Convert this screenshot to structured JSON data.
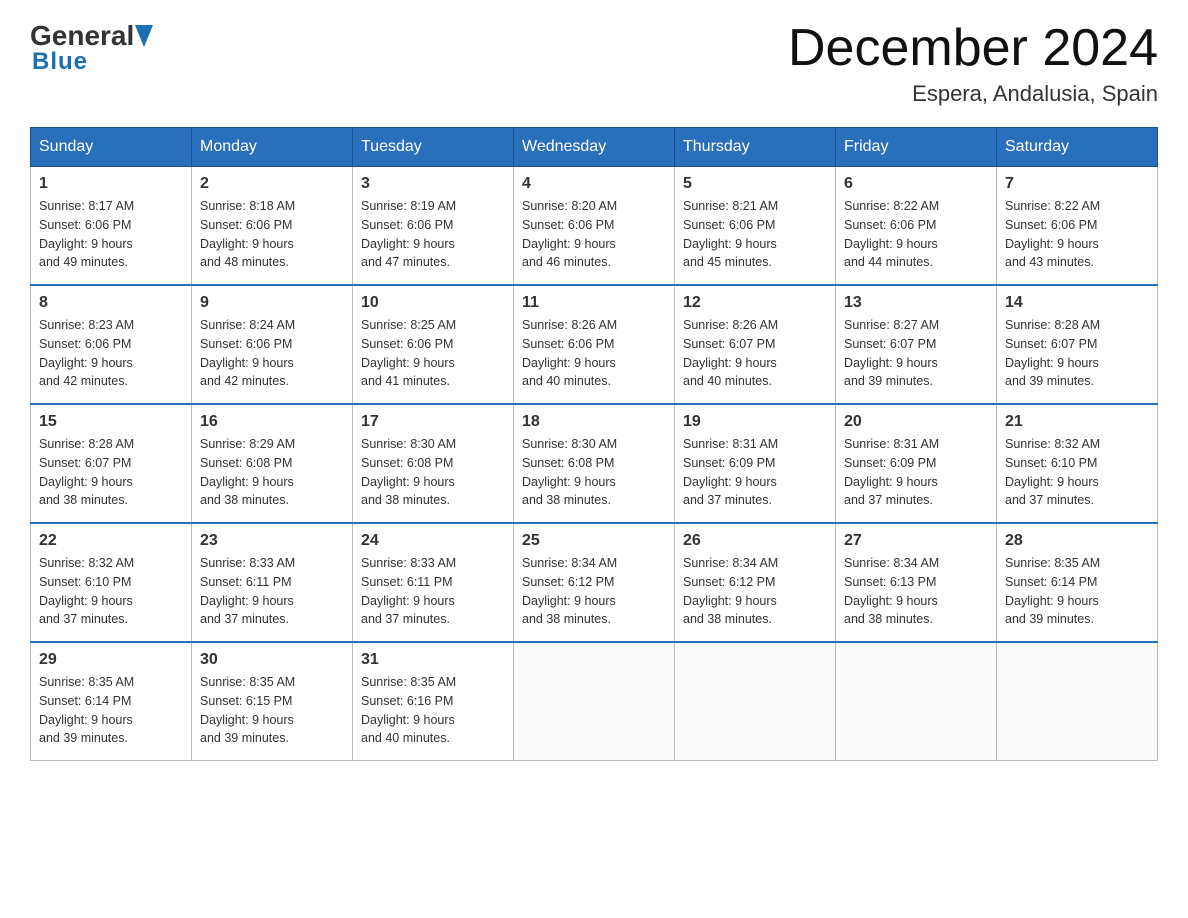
{
  "header": {
    "logo_general": "General",
    "logo_blue": "Blue",
    "month_title": "December 2024",
    "location": "Espera, Andalusia, Spain"
  },
  "calendar": {
    "days_of_week": [
      "Sunday",
      "Monday",
      "Tuesday",
      "Wednesday",
      "Thursday",
      "Friday",
      "Saturday"
    ],
    "weeks": [
      [
        {
          "day": "1",
          "sunrise": "8:17 AM",
          "sunset": "6:06 PM",
          "daylight": "9 hours and 49 minutes."
        },
        {
          "day": "2",
          "sunrise": "8:18 AM",
          "sunset": "6:06 PM",
          "daylight": "9 hours and 48 minutes."
        },
        {
          "day": "3",
          "sunrise": "8:19 AM",
          "sunset": "6:06 PM",
          "daylight": "9 hours and 47 minutes."
        },
        {
          "day": "4",
          "sunrise": "8:20 AM",
          "sunset": "6:06 PM",
          "daylight": "9 hours and 46 minutes."
        },
        {
          "day": "5",
          "sunrise": "8:21 AM",
          "sunset": "6:06 PM",
          "daylight": "9 hours and 45 minutes."
        },
        {
          "day": "6",
          "sunrise": "8:22 AM",
          "sunset": "6:06 PM",
          "daylight": "9 hours and 44 minutes."
        },
        {
          "day": "7",
          "sunrise": "8:22 AM",
          "sunset": "6:06 PM",
          "daylight": "9 hours and 43 minutes."
        }
      ],
      [
        {
          "day": "8",
          "sunrise": "8:23 AM",
          "sunset": "6:06 PM",
          "daylight": "9 hours and 42 minutes."
        },
        {
          "day": "9",
          "sunrise": "8:24 AM",
          "sunset": "6:06 PM",
          "daylight": "9 hours and 42 minutes."
        },
        {
          "day": "10",
          "sunrise": "8:25 AM",
          "sunset": "6:06 PM",
          "daylight": "9 hours and 41 minutes."
        },
        {
          "day": "11",
          "sunrise": "8:26 AM",
          "sunset": "6:06 PM",
          "daylight": "9 hours and 40 minutes."
        },
        {
          "day": "12",
          "sunrise": "8:26 AM",
          "sunset": "6:07 PM",
          "daylight": "9 hours and 40 minutes."
        },
        {
          "day": "13",
          "sunrise": "8:27 AM",
          "sunset": "6:07 PM",
          "daylight": "9 hours and 39 minutes."
        },
        {
          "day": "14",
          "sunrise": "8:28 AM",
          "sunset": "6:07 PM",
          "daylight": "9 hours and 39 minutes."
        }
      ],
      [
        {
          "day": "15",
          "sunrise": "8:28 AM",
          "sunset": "6:07 PM",
          "daylight": "9 hours and 38 minutes."
        },
        {
          "day": "16",
          "sunrise": "8:29 AM",
          "sunset": "6:08 PM",
          "daylight": "9 hours and 38 minutes."
        },
        {
          "day": "17",
          "sunrise": "8:30 AM",
          "sunset": "6:08 PM",
          "daylight": "9 hours and 38 minutes."
        },
        {
          "day": "18",
          "sunrise": "8:30 AM",
          "sunset": "6:08 PM",
          "daylight": "9 hours and 38 minutes."
        },
        {
          "day": "19",
          "sunrise": "8:31 AM",
          "sunset": "6:09 PM",
          "daylight": "9 hours and 37 minutes."
        },
        {
          "day": "20",
          "sunrise": "8:31 AM",
          "sunset": "6:09 PM",
          "daylight": "9 hours and 37 minutes."
        },
        {
          "day": "21",
          "sunrise": "8:32 AM",
          "sunset": "6:10 PM",
          "daylight": "9 hours and 37 minutes."
        }
      ],
      [
        {
          "day": "22",
          "sunrise": "8:32 AM",
          "sunset": "6:10 PM",
          "daylight": "9 hours and 37 minutes."
        },
        {
          "day": "23",
          "sunrise": "8:33 AM",
          "sunset": "6:11 PM",
          "daylight": "9 hours and 37 minutes."
        },
        {
          "day": "24",
          "sunrise": "8:33 AM",
          "sunset": "6:11 PM",
          "daylight": "9 hours and 37 minutes."
        },
        {
          "day": "25",
          "sunrise": "8:34 AM",
          "sunset": "6:12 PM",
          "daylight": "9 hours and 38 minutes."
        },
        {
          "day": "26",
          "sunrise": "8:34 AM",
          "sunset": "6:12 PM",
          "daylight": "9 hours and 38 minutes."
        },
        {
          "day": "27",
          "sunrise": "8:34 AM",
          "sunset": "6:13 PM",
          "daylight": "9 hours and 38 minutes."
        },
        {
          "day": "28",
          "sunrise": "8:35 AM",
          "sunset": "6:14 PM",
          "daylight": "9 hours and 39 minutes."
        }
      ],
      [
        {
          "day": "29",
          "sunrise": "8:35 AM",
          "sunset": "6:14 PM",
          "daylight": "9 hours and 39 minutes."
        },
        {
          "day": "30",
          "sunrise": "8:35 AM",
          "sunset": "6:15 PM",
          "daylight": "9 hours and 39 minutes."
        },
        {
          "day": "31",
          "sunrise": "8:35 AM",
          "sunset": "6:16 PM",
          "daylight": "9 hours and 40 minutes."
        },
        null,
        null,
        null,
        null
      ]
    ],
    "sunrise_label": "Sunrise:",
    "sunset_label": "Sunset:",
    "daylight_label": "Daylight:"
  }
}
